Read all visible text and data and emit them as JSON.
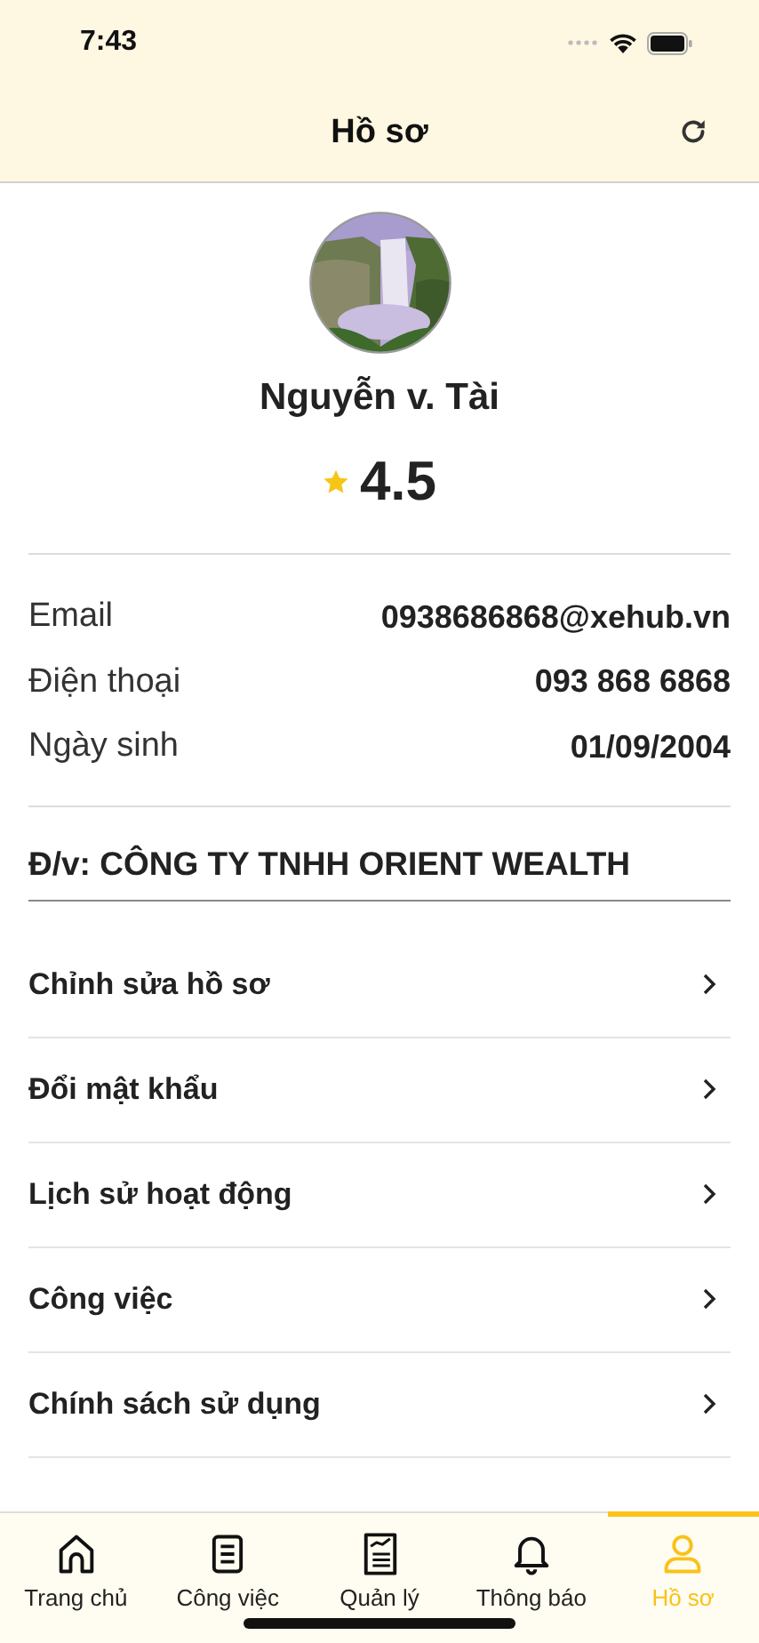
{
  "status_bar": {
    "time": "7:43"
  },
  "header": {
    "title": "Hồ sơ"
  },
  "profile": {
    "name": "Nguyễn v. Tài",
    "rating": "4.5"
  },
  "info": [
    {
      "label": "Email",
      "value": "0938686868@xehub.vn"
    },
    {
      "label": "Điện thoại",
      "value": "093 868 6868"
    },
    {
      "label": "Ngày sinh",
      "value": "01/09/2004"
    }
  ],
  "company": "Đ/v: CÔNG TY TNHH ORIENT WEALTH",
  "menu": [
    {
      "label": "Chỉnh sửa hồ sơ"
    },
    {
      "label": "Đổi mật khẩu"
    },
    {
      "label": "Lịch sử hoạt động"
    },
    {
      "label": "Công việc"
    },
    {
      "label": "Chính sách sử dụng"
    }
  ],
  "tabs": [
    {
      "label": "Trang chủ",
      "selected": false
    },
    {
      "label": "Công việc",
      "selected": false
    },
    {
      "label": "Quản lý",
      "selected": false
    },
    {
      "label": "Thông báo",
      "selected": false
    },
    {
      "label": "Hồ sơ",
      "selected": true
    }
  ]
}
